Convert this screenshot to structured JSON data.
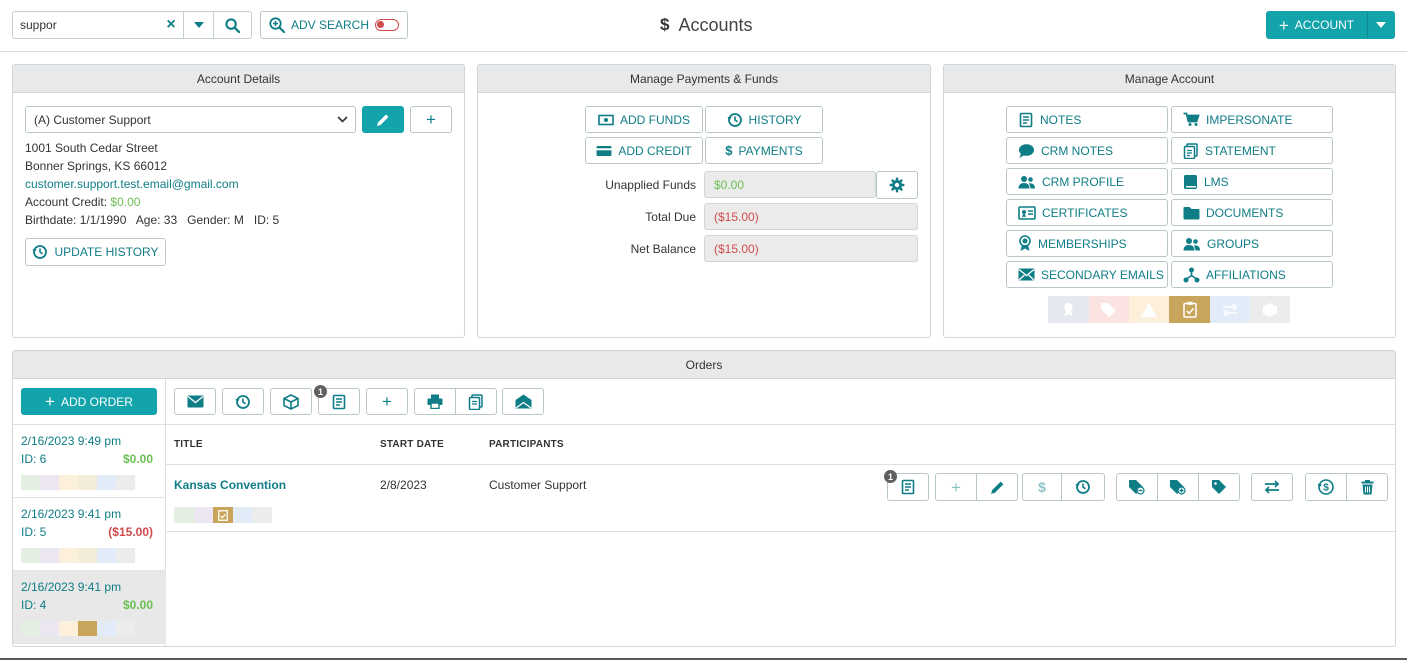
{
  "header": {
    "search_value": "suppor",
    "adv_search_label": "ADV SEARCH",
    "page_title": "Accounts",
    "add_account_label": "ACCOUNT"
  },
  "account_details": {
    "title": "Account Details",
    "selected_account": "(A) Customer Support",
    "address_line1": "1001 South Cedar Street",
    "address_line2": "Bonner Springs, KS 66012",
    "email": "customer.support.test.email@gmail.com",
    "credit_label": "Account Credit:",
    "credit_value": "$0.00",
    "birthdate": "Birthdate: 1/1/1990",
    "age": "Age: 33",
    "gender": "Gender: M",
    "id": "ID: 5",
    "update_history_label": "UPDATE HISTORY"
  },
  "payments": {
    "title": "Manage Payments & Funds",
    "add_funds": "ADD FUNDS",
    "history": "HISTORY",
    "add_credit": "ADD CREDIT",
    "payments_btn": "PAYMENTS",
    "unapplied_label": "Unapplied Funds",
    "unapplied_value": "$0.00",
    "total_due_label": "Total Due",
    "total_due_value": "($15.00)",
    "net_balance_label": "Net Balance",
    "net_balance_value": "($15.00)"
  },
  "manage_account": {
    "title": "Manage Account",
    "buttons": [
      "NOTES",
      "IMPERSONATE",
      "CRM NOTES",
      "STATEMENT",
      "CRM PROFILE",
      "LMS",
      "CERTIFICATES",
      "DOCUMENTS",
      "MEMBERSHIPS",
      "GROUPS",
      "SECONDARY EMAILS",
      "AFFILIATIONS"
    ],
    "icons": [
      "notes-icon",
      "cart-icon",
      "chat-icon",
      "statement-icon",
      "users-icon",
      "book-icon",
      "certificate-icon",
      "folder-icon",
      "ribbon-icon",
      "group-icon",
      "envelope-icon",
      "affiliation-icon"
    ]
  },
  "orders": {
    "title": "Orders",
    "add_order_label": "ADD ORDER",
    "notes_count": "1",
    "columns": {
      "title": "TITLE",
      "start_date": "START DATE",
      "participants": "PARTICIPANTS"
    },
    "row": {
      "title": "Kansas Convention",
      "start_date": "2/8/2023",
      "participants": "Customer Support",
      "notes_count": "1"
    },
    "list": [
      {
        "date": "2/16/2023 9:49 pm",
        "id": "ID: 6",
        "amount": "$0.00",
        "amount_color": "#6bbf52"
      },
      {
        "date": "2/16/2023 9:41 pm",
        "id": "ID: 5",
        "amount": "($15.00)",
        "amount_color": "#d24b4b"
      },
      {
        "date": "2/16/2023 9:41 pm",
        "id": "ID: 4",
        "amount": "$0.00",
        "amount_color": "#6bbf52"
      }
    ]
  },
  "colors": {
    "accent": "#12a3ab",
    "link_text": "#0f7d86",
    "positive": "#6bbf52",
    "negative": "#d24b4b",
    "status_active": "#c9a55c"
  }
}
